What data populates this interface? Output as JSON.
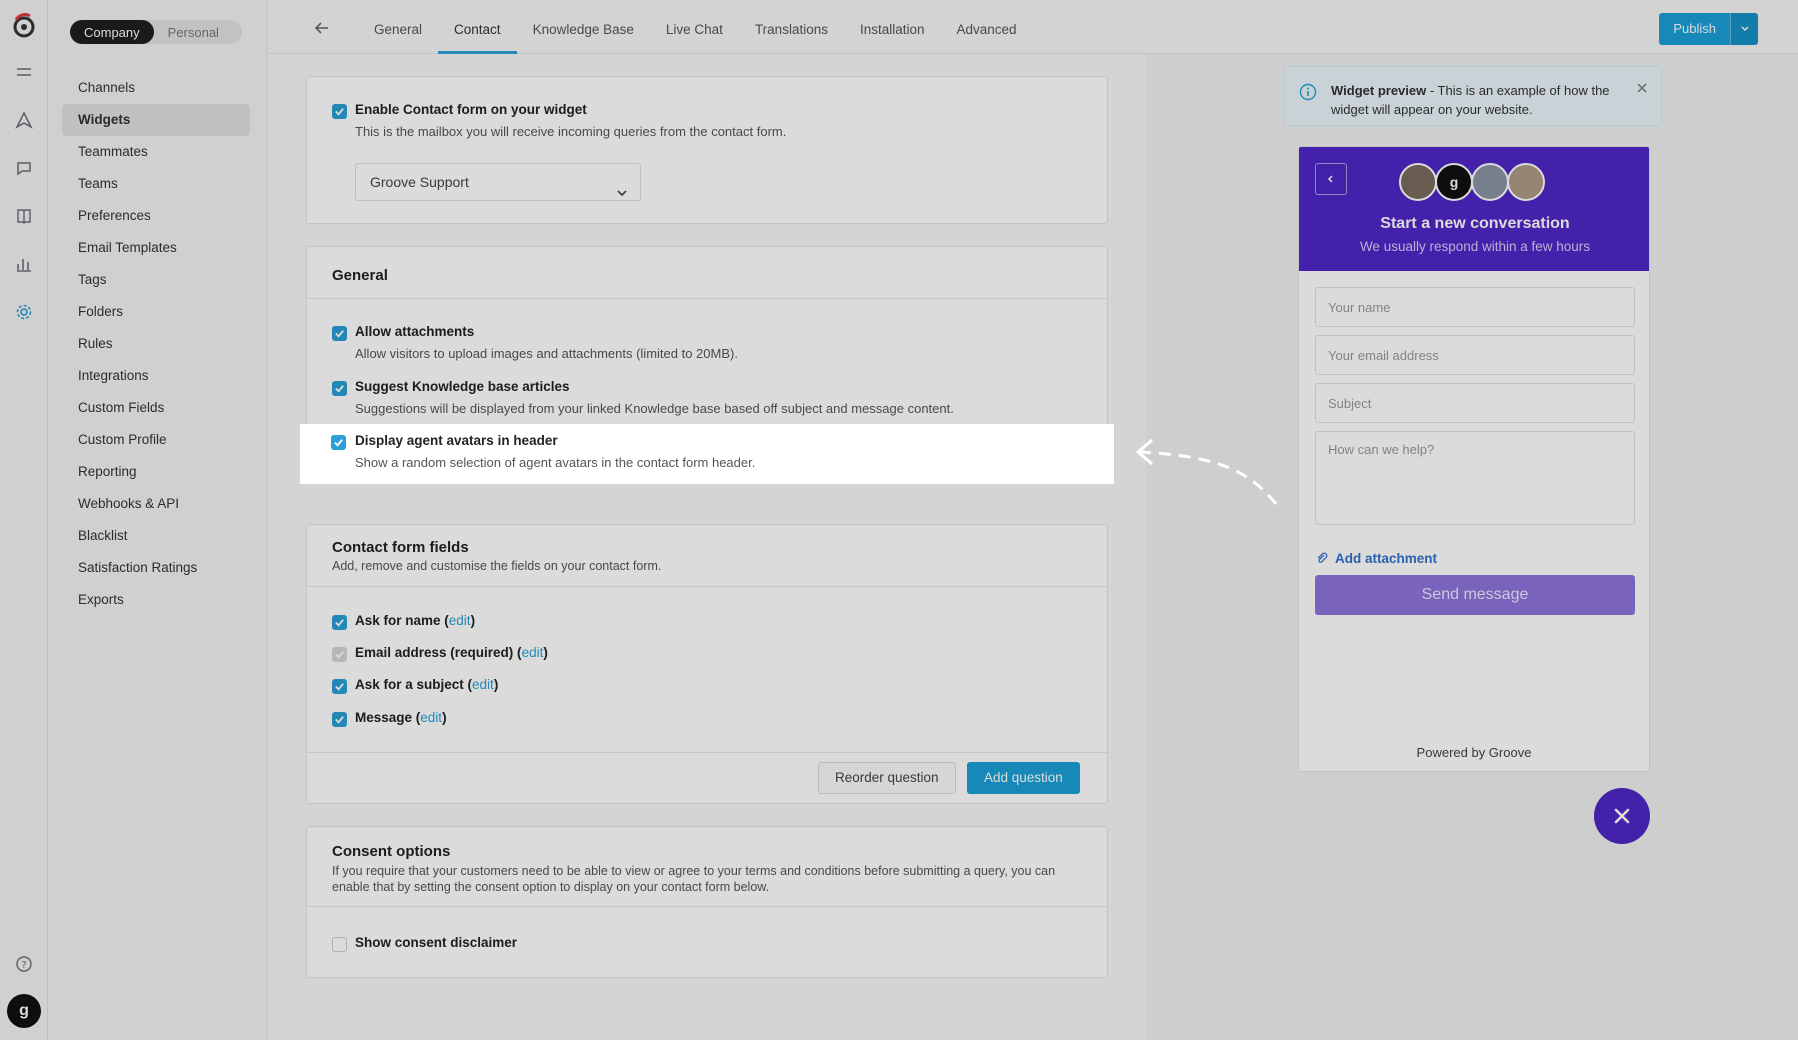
{
  "workspace_toggle": {
    "company": "Company",
    "personal": "Personal"
  },
  "sidebar": {
    "items": [
      {
        "label": "Channels"
      },
      {
        "label": "Widgets",
        "active": true
      },
      {
        "label": "Teammates"
      },
      {
        "label": "Teams"
      },
      {
        "label": "Preferences"
      },
      {
        "label": "Email Templates"
      },
      {
        "label": "Tags"
      },
      {
        "label": "Folders"
      },
      {
        "label": "Rules"
      },
      {
        "label": "Integrations"
      },
      {
        "label": "Custom Fields"
      },
      {
        "label": "Custom Profile"
      },
      {
        "label": "Reporting"
      },
      {
        "label": "Webhooks & API"
      },
      {
        "label": "Blacklist"
      },
      {
        "label": "Satisfaction Ratings"
      },
      {
        "label": "Exports"
      }
    ]
  },
  "tabs": [
    "General",
    "Contact",
    "Knowledge Base",
    "Live Chat",
    "Translations",
    "Installation",
    "Advanced"
  ],
  "active_tab": "Contact",
  "publish_label": "Publish",
  "contact_card": {
    "enable_label": "Enable Contact form on your widget",
    "enable_desc": "This is the mailbox you will receive incoming queries from the contact form.",
    "mailbox_value": "Groove Support"
  },
  "general_card": {
    "title": "General",
    "attachments_label": "Allow attachments",
    "attachments_desc": "Allow visitors to upload images and attachments (limited to 20MB).",
    "kb_label": "Suggest Knowledge base articles",
    "kb_desc": "Suggestions will be displayed from your linked Knowledge base based off subject and message content.",
    "avatars_label": "Display agent avatars in header",
    "avatars_desc": "Show a random selection of agent avatars in the contact form header."
  },
  "fields_card": {
    "title": "Contact form fields",
    "subtitle": "Add, remove and customise the fields on your contact form.",
    "fields": [
      {
        "label": "Ask for name (",
        "edit": "edit",
        "close": ")"
      },
      {
        "label": "Email address (required) (",
        "edit": "edit",
        "close": ")"
      },
      {
        "label": "Ask for a subject (",
        "edit": "edit",
        "close": ")"
      },
      {
        "label": "Message (",
        "edit": "edit",
        "close": ")"
      }
    ],
    "reorder_label": "Reorder question",
    "add_label": "Add question"
  },
  "consent_card": {
    "title": "Consent options",
    "desc_line1": "If you require that your customers need to be able to view or agree to your terms and conditions before submitting a query, you can",
    "desc_line2": "enable that by setting the consent option to display on your contact form below.",
    "show_label": "Show consent disclaimer"
  },
  "preview": {
    "notice_bold": "Widget preview",
    "notice_text": " - This is an example of how the widget will appear on your website.",
    "title": "Start a new conversation",
    "subtitle": "We usually respond within a few hours",
    "name_placeholder": "Your name",
    "email_placeholder": "Your email address",
    "subject_placeholder": "Subject",
    "message_placeholder": "How can we help?",
    "attach_label": "Add attachment",
    "send_label": "Send message",
    "powered_by": "Powered by Groove"
  },
  "colors": {
    "accent": "#1ba0d8",
    "widget_brand": "#4f27c6"
  }
}
